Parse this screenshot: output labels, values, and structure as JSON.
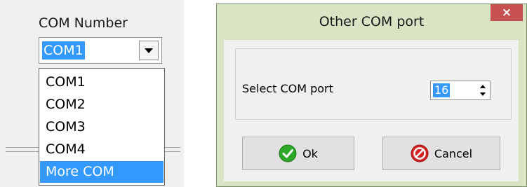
{
  "com_panel": {
    "label": "COM Number",
    "selected_value": "COM1",
    "dropdown_items": [
      "COM1",
      "COM2",
      "COM3",
      "COM4",
      "More COM"
    ],
    "highlighted_item": "More COM"
  },
  "dialog": {
    "title": "Other COM port",
    "close_icon": "×",
    "select_label": "Select COM port",
    "spin_value": "16",
    "ok_label": "Ok",
    "cancel_label": "Cancel"
  },
  "colors": {
    "selection": "#3399ff",
    "dialog_frame": "#d8e4c4",
    "close_button": "#c75050",
    "ok_icon": "#2fa82a",
    "cancel_icon": "#d42020"
  },
  "icons": {
    "combo_arrow": "chevron-down-icon",
    "ok": "check-icon",
    "cancel": "no-entry-icon",
    "close": "close-icon",
    "spin": "spin-arrows-icon"
  }
}
